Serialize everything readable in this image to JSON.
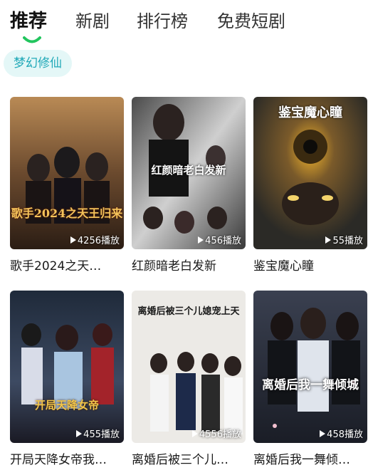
{
  "tabs": [
    {
      "label": "推荐"
    },
    {
      "label": "新剧"
    },
    {
      "label": "排行榜"
    },
    {
      "label": "免费短剧"
    }
  ],
  "filter_chip": "梦幻修仙",
  "accent_color": "#22c55e",
  "cards": [
    {
      "title": "歌手2024之天…",
      "plays": "4256播放",
      "poster_text": "歌手2024之天王归来"
    },
    {
      "title": "红颜暗老白发新",
      "plays": "456播放",
      "poster_text": "红颜暗老白发新"
    },
    {
      "title": "鉴宝魔心瞳",
      "plays": "55播放",
      "poster_text": "鉴宝魔心瞳"
    },
    {
      "title": "开局天降女帝我…",
      "plays": "455播放",
      "poster_text": "开局天降女帝"
    },
    {
      "title": "离婚后被三个儿…",
      "plays": "4556播放",
      "poster_text": "离婚后被三个儿媳宠上天"
    },
    {
      "title": "离婚后我一舞倾…",
      "plays": "458播放",
      "poster_text": "离婚后我一舞倾城"
    }
  ]
}
